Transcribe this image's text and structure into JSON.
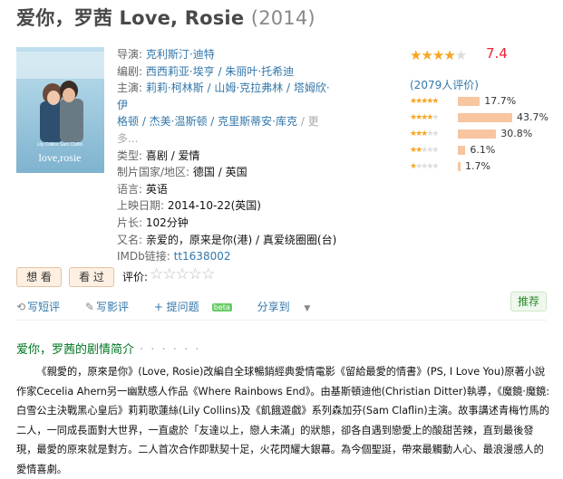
{
  "title": {
    "main": "爱你，罗茜 Love, Rosie",
    "year": "(2014)"
  },
  "poster": {
    "names": "Lily Collins   Sam Claflin",
    "logo": "love,rosie"
  },
  "info": {
    "director_label": "导演:",
    "director": "克利斯汀·迪特",
    "writer_label": "编剧:",
    "writer": "西西莉亚·埃亨 / 朱丽叶·托希迪",
    "cast_label": "主演:",
    "cast_line1": "莉莉·柯林斯 / 山姆·克拉弗林 / 塔姆欣·伊",
    "cast_line2": "格顿 / 杰美·温斯顿 / 克里斯蒂安·库克",
    "cast_more": "/ 更多...",
    "genre_label": "类型:",
    "genre": "喜剧 / 爱情",
    "country_label": "制片国家/地区:",
    "country": "德国 / 英国",
    "language_label": "语言:",
    "language": "英语",
    "date_label": "上映日期:",
    "date": "2014-10-22(英国)",
    "runtime_label": "片长:",
    "runtime": "102分钟",
    "aka_label": "又名:",
    "aka": "亲爱的，原来是你(港) / 真爱绕圈圈(台)",
    "imdb_label": "IMDb链接:",
    "imdb": "tt1638002"
  },
  "rating": {
    "score": "7.4",
    "votes": "(2079人评价)",
    "stars_filled": 3.5,
    "distribution": [
      {
        "stars": 5,
        "pct_value": 17.7,
        "pct": "17.7%"
      },
      {
        "stars": 4,
        "pct_value": 43.7,
        "pct": "43.7%"
      },
      {
        "stars": 3,
        "pct_value": 30.8,
        "pct": "30.8%"
      },
      {
        "stars": 2,
        "pct_value": 6.1,
        "pct": "6.1%"
      },
      {
        "stars": 1,
        "pct_value": 1.7,
        "pct": "1.7%"
      }
    ]
  },
  "buttons": {
    "want": "想 看",
    "seen": "看 过",
    "rate_label": "评价:"
  },
  "actions": {
    "short_review": "写短评",
    "review": "写影评",
    "question": "+ 提问题",
    "beta": "beta",
    "share": "分享到",
    "share_arrow": "▼",
    "recommend": "推荐"
  },
  "section": {
    "title": "爱你，罗茜的剧情简介",
    "dots": "· · · · · ·"
  },
  "summary": "《親愛的，原來是你》(Love, Rosie)改編自全球暢銷經典愛情電影《留給最愛的情書》(PS, I Love You)原著小說作家Cecelia Ahern另一幽默感人作品《Where Rainbows End》。由基斯頓迪他(Christian Ditter)執導，《魔鏡·魔鏡:白雪公主決戰黑心皇后》莉莉歌蓮絲(Lily Collins)及《飢餓遊戲》系列森加芬(Sam Claflin)主演。故事講述青梅竹馬的二人，一同成長面對大世界，一直處於「友達以上，戀人未滿」的狀態，卻各自遇到戀愛上的酸甜苦辣，直到最後發現，最愛的原來就是對方。二人首次合作即默契十足，火花閃耀大銀幕。為今個聖誕，帶來最觸動人心、最浪漫感人的愛情喜劇。",
  "colors": {
    "link": "#3377aa",
    "star": "#f6a623",
    "score": "#ee2233",
    "bar": "#f7c5a0",
    "green": "#007722"
  }
}
